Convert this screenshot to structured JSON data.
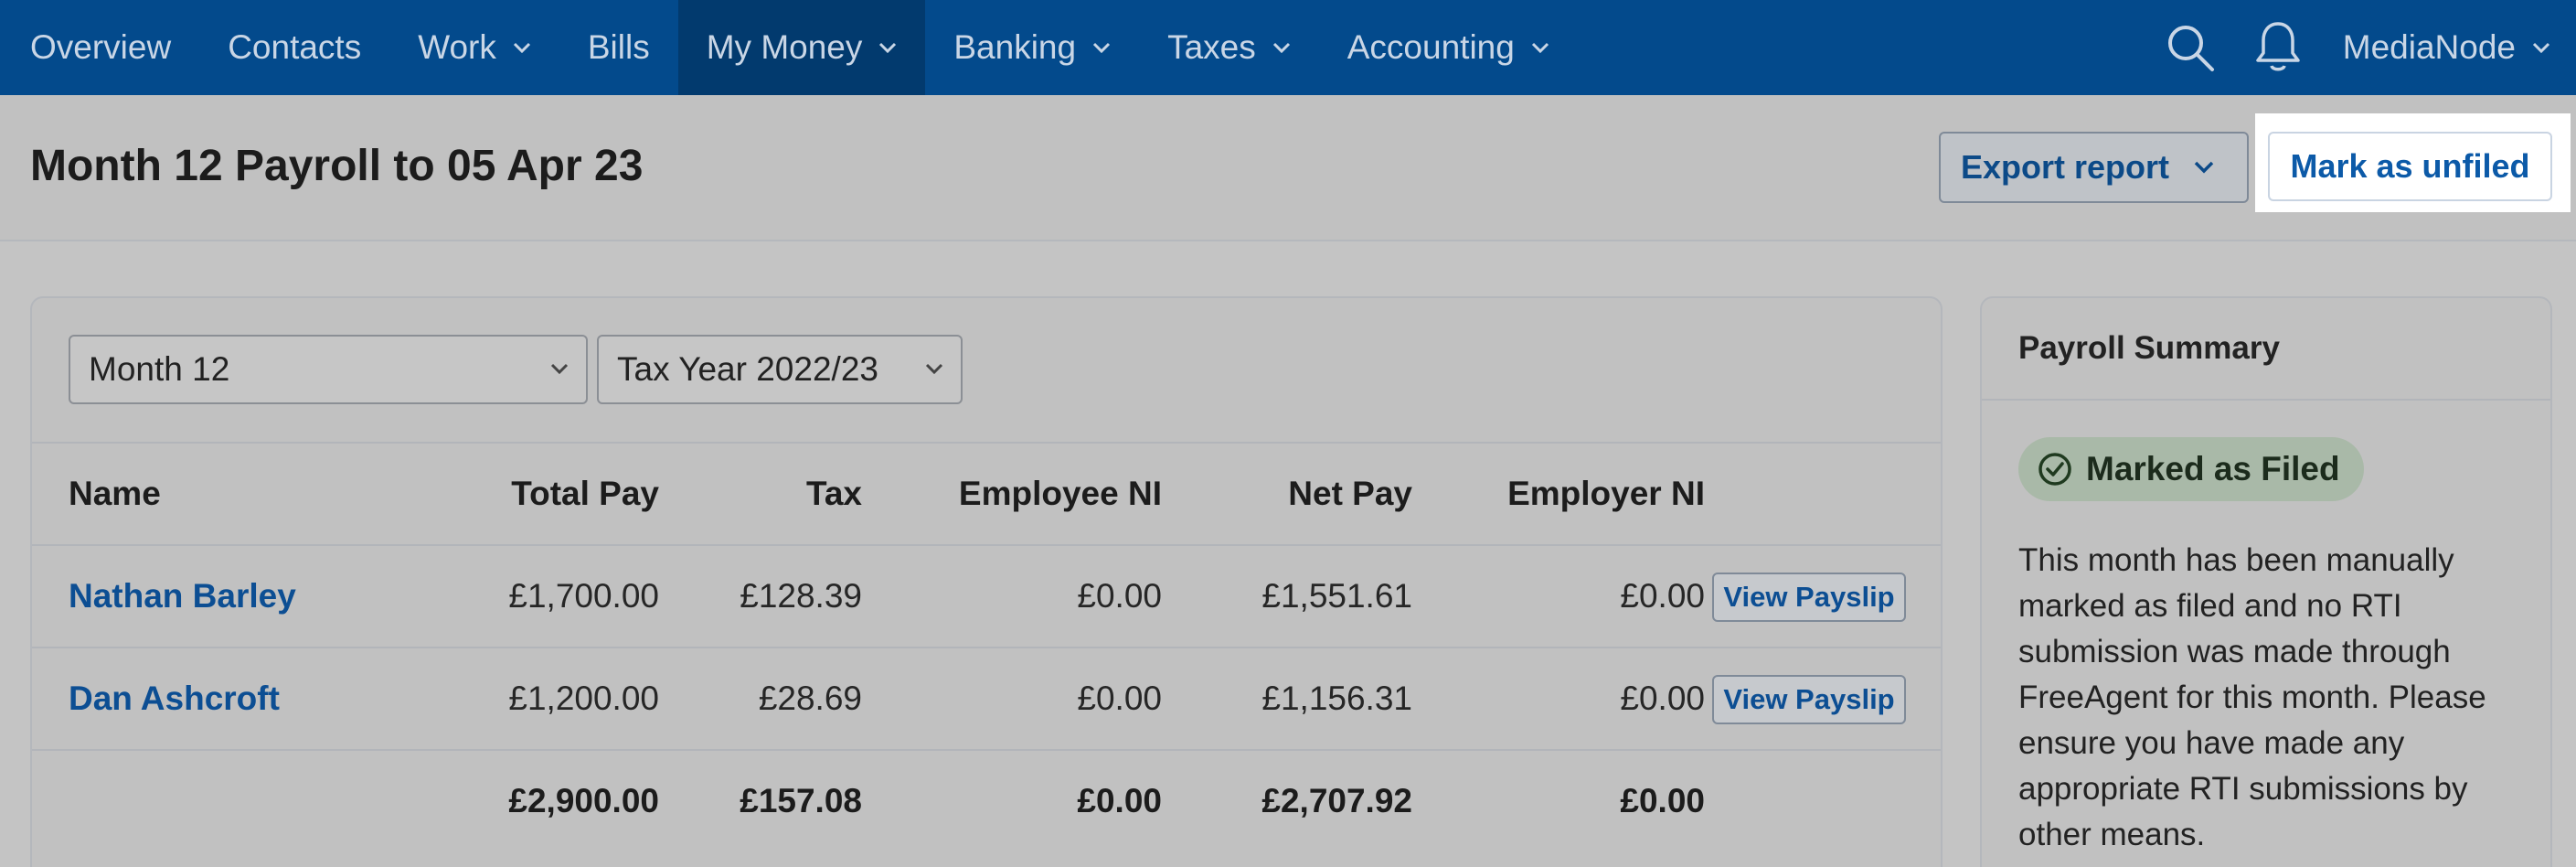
{
  "nav": {
    "items": [
      {
        "label": "Overview",
        "dropdown": false,
        "active": false
      },
      {
        "label": "Contacts",
        "dropdown": false,
        "active": false
      },
      {
        "label": "Work",
        "dropdown": true,
        "active": false
      },
      {
        "label": "Bills",
        "dropdown": false,
        "active": false
      },
      {
        "label": "My Money",
        "dropdown": true,
        "active": true
      },
      {
        "label": "Banking",
        "dropdown": true,
        "active": false
      },
      {
        "label": "Taxes",
        "dropdown": true,
        "active": false
      },
      {
        "label": "Accounting",
        "dropdown": true,
        "active": false
      }
    ],
    "search_icon": "search-icon",
    "notifications_icon": "bell-icon",
    "account_name": "MediaNode"
  },
  "header": {
    "title": "Month 12 Payroll to 05 Apr 23",
    "export_label": "Export report",
    "unfile_label": "Mark as unfiled"
  },
  "filters": {
    "month": "Month 12",
    "tax_year": "Tax Year 2022/23"
  },
  "table": {
    "columns": [
      "Name",
      "Total Pay",
      "Tax",
      "Employee NI",
      "Net Pay",
      "Employer NI"
    ],
    "rows": [
      {
        "name": "Nathan Barley",
        "total_pay": "£1,700.00",
        "tax": "£128.39",
        "employee_ni": "£0.00",
        "net_pay": "£1,551.61",
        "employer_ni": "£0.00",
        "action": "View Payslip"
      },
      {
        "name": "Dan Ashcroft",
        "total_pay": "£1,200.00",
        "tax": "£28.69",
        "employee_ni": "£0.00",
        "net_pay": "£1,156.31",
        "employer_ni": "£0.00",
        "action": "View Payslip"
      }
    ],
    "totals": {
      "total_pay": "£2,900.00",
      "tax": "£157.08",
      "employee_ni": "£0.00",
      "net_pay": "£2,707.92",
      "employer_ni": "£0.00"
    }
  },
  "summary": {
    "title": "Payroll Summary",
    "status": "Marked as Filed",
    "status_icon": "check-circle-icon",
    "text_lines": [
      "This month has been manually",
      "marked as filed and no RTI",
      "submission was made through",
      "FreeAgent for this month. Please",
      "ensure you have made any",
      "appropriate RTI submissions by",
      "other means."
    ]
  },
  "colors": {
    "nav_bg": "#034a8c",
    "nav_active": "#023a6e",
    "link": "#0c4e93",
    "badge_bg": "#a9b9a8"
  }
}
